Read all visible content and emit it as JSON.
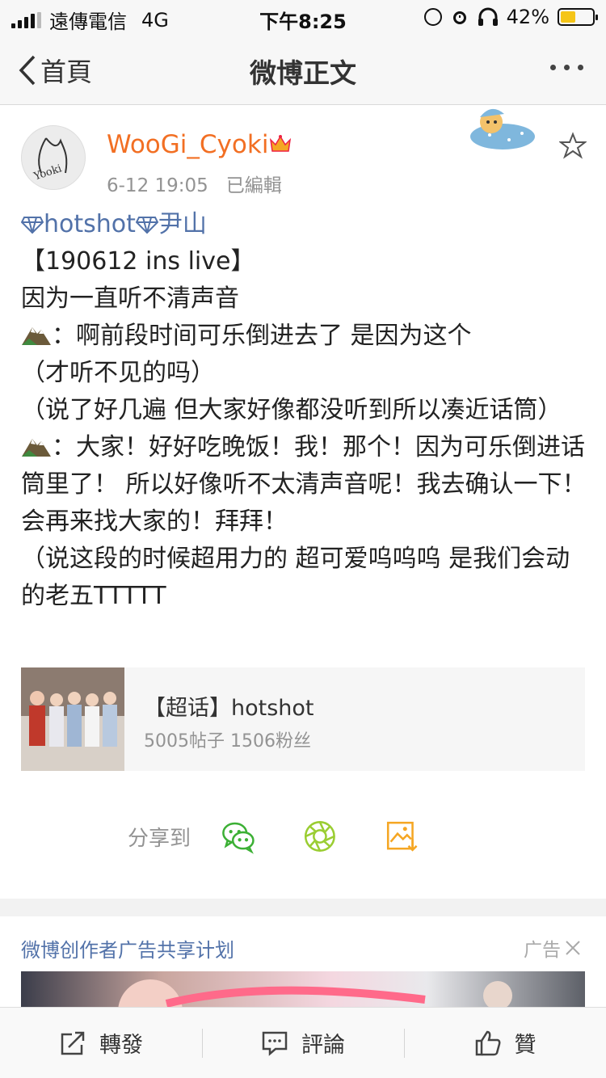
{
  "status_bar": {
    "carrier": "遠傳電信",
    "network": "4G",
    "time": "下午8:25",
    "battery": "42%",
    "battery_level": 0.42
  },
  "nav": {
    "back_label": "首頁",
    "title": "微博正文"
  },
  "post": {
    "avatar_text": "Yooki",
    "username": "WooGi_Cyoki",
    "date": "6-12 19:05",
    "edited": "已編輯",
    "topic": "hotshot",
    "topic_suffix": "尹山",
    "lines": [
      "【190612 ins live】",
      "因为一直听不清声音",
      "：啊前段时间可乐倒进去了 是因为这个",
      "（才听不见的吗）",
      "（说了好几遍 但大家好像都没听到所以凑近话筒）",
      "：大家！好好吃晚饭！我！那个！因为可乐倒进话筒里了！ 所以好像听不太清声音呢！我去确认一下！会再来找大家的！拜拜！",
      "（说这段的时候超用力的 超可爱呜呜呜 是我们会动的老五TTTTT"
    ]
  },
  "topic_card": {
    "title": "【超话】hotshot",
    "subtitle": "5005帖子 1506粉丝"
  },
  "share": {
    "label": "分享到"
  },
  "ad": {
    "title": "微博创作者广告共享计划",
    "tag": "广告"
  },
  "bottom_bar": {
    "repost": "轉發",
    "comment": "評論",
    "like": "贊"
  },
  "colors": {
    "username": "#f26f23",
    "link": "#5272a9",
    "wechat": "#3cb035",
    "moments": "#9acd32",
    "save": "#f5a623"
  }
}
